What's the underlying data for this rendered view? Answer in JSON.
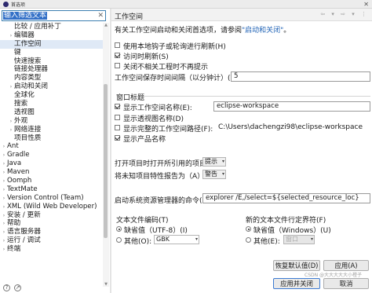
{
  "window": {
    "title": "首选项",
    "close_glyph": "✕"
  },
  "filter": {
    "value": "输入筛选文本",
    "clear_glyph": "✕"
  },
  "tree": [
    {
      "label": "比较 / 应用补丁",
      "indent": 1,
      "arrow": ""
    },
    {
      "label": "编辑器",
      "indent": 1,
      "arrow": "›"
    },
    {
      "label": "工作空间",
      "indent": 1,
      "arrow": "",
      "selected": true
    },
    {
      "label": "键",
      "indent": 1,
      "arrow": ""
    },
    {
      "label": "快速搜索",
      "indent": 1,
      "arrow": ""
    },
    {
      "label": "链接处理器",
      "indent": 1,
      "arrow": ""
    },
    {
      "label": "内容类型",
      "indent": 1,
      "arrow": ""
    },
    {
      "label": "启动和关闭",
      "indent": 1,
      "arrow": "›"
    },
    {
      "label": "全球化",
      "indent": 1,
      "arrow": ""
    },
    {
      "label": "搜索",
      "indent": 1,
      "arrow": ""
    },
    {
      "label": "透视图",
      "indent": 1,
      "arrow": ""
    },
    {
      "label": "外观",
      "indent": 1,
      "arrow": "›"
    },
    {
      "label": "网络连接",
      "indent": 1,
      "arrow": "›"
    },
    {
      "label": "项目性质",
      "indent": 1,
      "arrow": ""
    },
    {
      "label": "Ant",
      "indent": 0,
      "arrow": "›"
    },
    {
      "label": "Gradle",
      "indent": 0,
      "arrow": "›"
    },
    {
      "label": "Java",
      "indent": 0,
      "arrow": "›"
    },
    {
      "label": "Maven",
      "indent": 0,
      "arrow": "›"
    },
    {
      "label": "Oomph",
      "indent": 0,
      "arrow": "›"
    },
    {
      "label": "TextMate",
      "indent": 0,
      "arrow": "›"
    },
    {
      "label": "Version Control (Team)",
      "indent": 0,
      "arrow": "›"
    },
    {
      "label": "XML (Wild Web Developer)",
      "indent": 0,
      "arrow": "›"
    },
    {
      "label": "安装 / 更新",
      "indent": 0,
      "arrow": "›"
    },
    {
      "label": "帮助",
      "indent": 0,
      "arrow": "›"
    },
    {
      "label": "语言服务器",
      "indent": 0,
      "arrow": "›"
    },
    {
      "label": "运行 / 调试",
      "indent": 0,
      "arrow": "›"
    },
    {
      "label": "终端",
      "indent": 0,
      "arrow": "›"
    }
  ],
  "footer_icons": [
    "?",
    "↗"
  ],
  "page": {
    "title": "工作空间",
    "nav": "⇦ ▾ ⇨ ▾ ⋮",
    "intro_prefix": "有关工作空间启动和关闭首选项，请参阅",
    "intro_link": "\"启动和关闭\"",
    "intro_suffix": "。",
    "cb_native_hooks": "使用本地钩子或轮询进行刷新(H)",
    "cb_refresh_on_access": "访问时刷新(S)",
    "cb_close_unrelated": "关闭不相关工程时不再提示",
    "save_interval_label": "工作空间保存时间间隔（以分钟计）(W):",
    "save_interval_value": "5",
    "window_title_group": "窗口标题",
    "cb_show_ws_name": "显示工作空间名称(E):",
    "ws_name_value": "eclipse-workspace",
    "cb_show_perspective": "显示透视图名称(D)",
    "cb_show_full_path": "显示完整的工作空间路径(F):",
    "full_path_value": "C:\\Users\\dachengzi98\\eclipse-workspace",
    "cb_show_product": "显示产品名称",
    "open_referenced_label": "打开项目时打开所引用的项目:",
    "open_referenced_value": "提示",
    "unknown_nature_label": "将未知项目特性报告为（A）:",
    "unknown_nature_value": "警告",
    "explorer_cmd_label": "启动系统资源管理器的命令(X):",
    "explorer_cmd_value": "explorer /E,/select=${selected_resource_loc}",
    "encoding_group": "文本文件编码(T)",
    "encoding_default": "缺省值（UTF-8）(I)",
    "encoding_other": "其他(O):",
    "encoding_other_value": "GBK",
    "delimiter_group": "新的文本文件行定界符(F)",
    "delimiter_default": "缺省值（Windows）(U)",
    "delimiter_other": "其他(E):",
    "delimiter_other_value": "窗口",
    "restore_defaults": "恢复默认值(D)",
    "apply": "应用(A)",
    "apply_close": "应用并关闭",
    "cancel": "取消",
    "watermark": "CSDN @大大大大大小橙子"
  },
  "colors": {
    "selection": "#3370c7",
    "link": "#1f62b5",
    "primary_border": "#3d7bd2"
  }
}
